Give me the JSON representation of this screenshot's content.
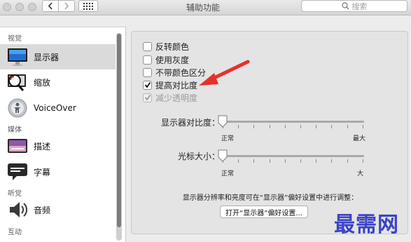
{
  "window": {
    "title": "辅助功能"
  },
  "search": {
    "placeholder": "搜索"
  },
  "sidebar": {
    "sections": [
      "视觉",
      "媒体",
      "听觉",
      "互动"
    ],
    "items": [
      {
        "label": "显示器",
        "icon": "display-icon",
        "selected": true
      },
      {
        "label": "缩放",
        "icon": "zoom-icon",
        "selected": false
      },
      {
        "label": "VoiceOver",
        "icon": "voiceover-icon",
        "selected": false
      },
      {
        "label": "描述",
        "icon": "description-icon",
        "selected": false
      },
      {
        "label": "字幕",
        "icon": "captions-icon",
        "selected": false
      },
      {
        "label": "音频",
        "icon": "audio-icon",
        "selected": false
      }
    ]
  },
  "options": [
    {
      "label": "反转颜色",
      "checked": false,
      "disabled": false
    },
    {
      "label": "使用灰度",
      "checked": false,
      "disabled": false
    },
    {
      "label": "不带颜色区分",
      "checked": false,
      "disabled": false
    },
    {
      "label": "提高对比度",
      "checked": true,
      "disabled": false
    },
    {
      "label": "减少透明度",
      "checked": true,
      "disabled": true
    }
  ],
  "contrast": {
    "label": "显示器对比度：",
    "min_label": "正常",
    "max_label": "最大",
    "value": 0
  },
  "cursor": {
    "label": "光标大小：",
    "min_label": "正常",
    "max_label": "大",
    "value": 0
  },
  "note": "显示器分辨率和亮度可在“显示器”偏好设置中进行调整：",
  "open_button": "打开“显示器”偏好设置...",
  "watermark": "最需网",
  "colors": {
    "arrow": "#e8302a",
    "watermark": "#3a44c4",
    "selection": "#dadada"
  }
}
